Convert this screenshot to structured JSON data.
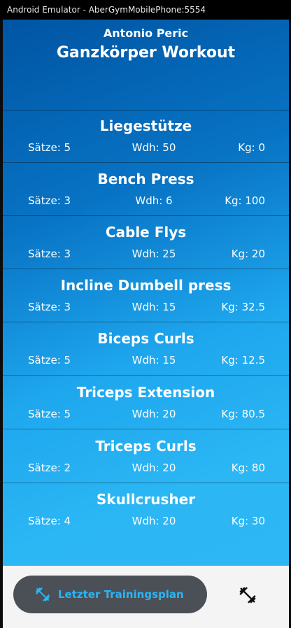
{
  "window": {
    "title": "Android Emulator - AberGymMobilePhone:5554"
  },
  "header": {
    "user_name": "Antonio Peric",
    "workout_title": "Ganzkörper Workout"
  },
  "exercises": [
    {
      "name": "Liegestütze",
      "sets": "Sätze: 5",
      "reps": "Wdh: 50",
      "kg": "Kg: 0"
    },
    {
      "name": "Bench Press",
      "sets": "Sätze: 3",
      "reps": "Wdh: 6",
      "kg": "Kg: 100"
    },
    {
      "name": "Cable Flys",
      "sets": "Sätze: 3",
      "reps": "Wdh: 25",
      "kg": "Kg: 20"
    },
    {
      "name": "Incline Dumbell press",
      "sets": "Sätze: 3",
      "reps": "Wdh: 15",
      "kg": "Kg: 32.5"
    },
    {
      "name": "Biceps Curls",
      "sets": "Sätze: 5",
      "reps": "Wdh: 15",
      "kg": "Kg: 12.5"
    },
    {
      "name": "Triceps Extension",
      "sets": "Sätze: 5",
      "reps": "Wdh: 20",
      "kg": "Kg: 80.5"
    },
    {
      "name": "Triceps Curls",
      "sets": "Sätze: 2",
      "reps": "Wdh: 20",
      "kg": "Kg: 80"
    },
    {
      "name": "Skullcrusher",
      "sets": "Sätze: 4",
      "reps": "Wdh: 20",
      "kg": "Kg: 30"
    }
  ],
  "bottom_bar": {
    "plan_button_label": "Letzter Trainingsplan",
    "plan_button_icon": "dumbbell-icon",
    "fab_icon": "dumbbell-icon",
    "accent_color": "#29b6f6"
  }
}
